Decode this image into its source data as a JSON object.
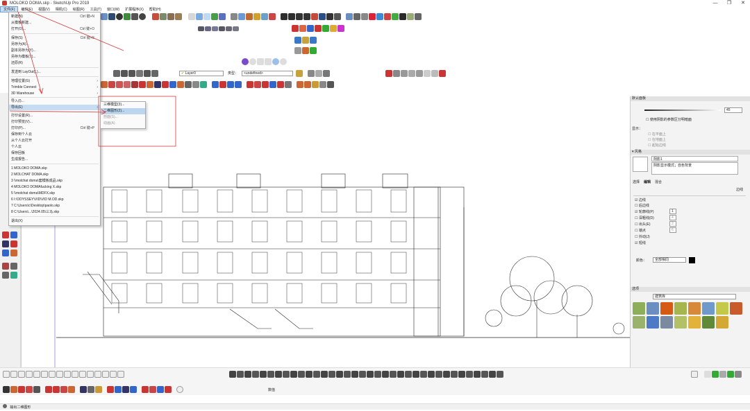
{
  "window": {
    "title": "MOLOKO DOMA.skp - SketchUp Pro 2019",
    "minimize": "—",
    "maximize": "❐",
    "close": "✕"
  },
  "menubar": [
    "文件(F)",
    "编辑(E)",
    "视图(V)",
    "相机(C)",
    "绘图(R)",
    "工具(T)",
    "窗口(W)",
    "扩展程序(X)",
    "帮助(H)"
  ],
  "file_menu": {
    "items": [
      {
        "label": "新建(N)",
        "shortcut": "Ctrl 键+N"
      },
      {
        "label": "从模板新建..."
      },
      {
        "label": "打开(O)...",
        "shortcut": "Ctrl 键+O"
      },
      {
        "label": "保存(S)",
        "shortcut": "Ctrl 键+S"
      },
      {
        "label": "另存为(A)..."
      },
      {
        "label": "副本另存为(Y)..."
      },
      {
        "label": "另存为模板(T)..."
      },
      {
        "label": "还原(R)"
      },
      {
        "label": "发送到 LayOut(L)..."
      },
      {
        "label": "地理位置(G)",
        "submenu": true
      },
      {
        "label": "Trimble Connect",
        "submenu": true
      },
      {
        "label": "3D Warehouse",
        "submenu": true
      },
      {
        "label": "导入(I)..."
      },
      {
        "label": "导出(E)",
        "submenu": true,
        "highlighted": true
      },
      {
        "label": "打印设置(R)..."
      },
      {
        "label": "打印预览(V)..."
      },
      {
        "label": "打印(P)...",
        "shortcut": "Ctrl 键+P"
      },
      {
        "label": "保存到个人云"
      },
      {
        "label": "从个人云打开"
      },
      {
        "label": "个人云"
      },
      {
        "label": "保存回板"
      },
      {
        "label": "生成报告..."
      },
      {
        "label": "1 MOLOKO DOMA.skp"
      },
      {
        "label": "2 MOLCHAT DOMA.skp"
      },
      {
        "label": "3 \\\\molchat doma\\套模板成品.skp"
      },
      {
        "label": "4 MOLOKO DOMAfucking X.skp"
      },
      {
        "label": "5 \\\\molchat doma\\MDFX.skp"
      },
      {
        "label": "6 I:\\ODYSSEY\\VID\\VID M.OD.skp"
      },
      {
        "label": "7 C:\\Users\\c\\Desktop\\paolo.skp"
      },
      {
        "label": "8 C:\\Users\\...\\2024.05\\三马.skp"
      },
      {
        "label": "退出(X)"
      }
    ]
  },
  "export_submenu": [
    "三维模型(3)...",
    "二维图形(2)...",
    "剖面(S)...",
    "动画(A)"
  ],
  "toolbar": {
    "layer_label": "Layer0",
    "type_label": "类型：",
    "type_value": "<undefined>"
  },
  "tray": {
    "default_panel": "默认面板",
    "softness_value": "45",
    "checkbox_label": "使用阴影的参数区分明暗面",
    "hint_label": "显示：",
    "face_options": [
      "在平面上",
      "在地面上",
      "起始边线"
    ],
    "styles_header": "▾ 风格",
    "style_name": "阴影1",
    "style_desc": "阴影显示模式；自色背景",
    "style_tabs": [
      "选择",
      "编辑",
      "混合"
    ],
    "edge_label": "边线",
    "edge_options": [
      {
        "label": "边线",
        "checked": true
      },
      {
        "label": "后边线",
        "checked": false
      },
      {
        "label": "轮廓线(P)",
        "checked": true,
        "value": "1"
      },
      {
        "label": "深粗线(D)",
        "checked": false,
        "value": "4"
      },
      {
        "label": "出头(E)",
        "checked": false,
        "value": "2"
      },
      {
        "label": "端点",
        "checked": false,
        "value": "6"
      },
      {
        "label": "抖动(J)",
        "checked": false
      },
      {
        "label": "短线",
        "checked": true
      }
    ],
    "color_label": "颜色：",
    "color_value": "全部相同",
    "materials_header": "选项",
    "material_lib": "建筑库"
  },
  "status_bar": {
    "hint": "输出二维图形",
    "measure_label": "数值"
  },
  "colors": {
    "menu_highlight": "#c6dcf2",
    "arrow_red": "#d93a3a",
    "swatches": [
      "#8fae5b",
      "#d55a14",
      "#a7b54e",
      "#d78838",
      "#6f99c8",
      "#c5c94a",
      "#c85a2c",
      "#9ab26b",
      "#4d7ac7",
      "#7a8aa0",
      "#b3c066",
      "#e2b23a",
      "#5e8a3a",
      "#d4a834"
    ]
  }
}
